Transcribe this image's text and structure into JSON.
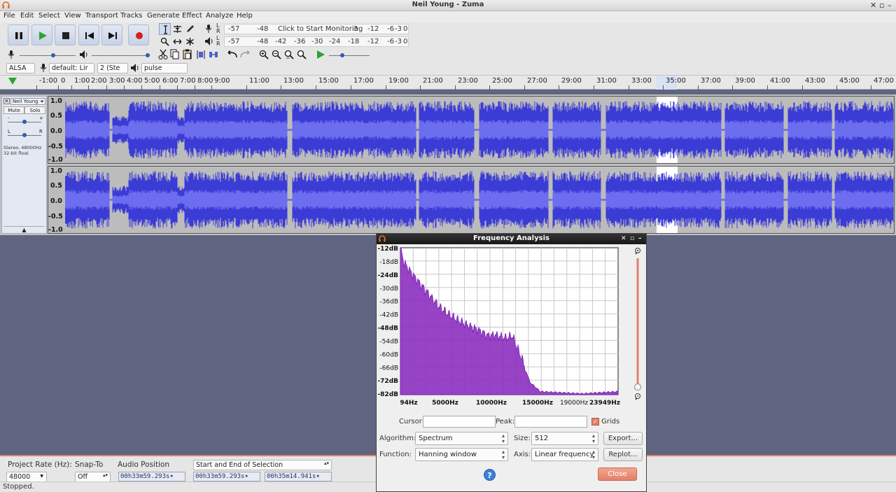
{
  "window": {
    "title": "Neil Young - Zuma"
  },
  "menu": [
    "File",
    "Edit",
    "Select",
    "View",
    "Transport",
    "Tracks",
    "Generate",
    "Effect",
    "Analyze",
    "Help"
  ],
  "meter": {
    "rec_channels": "L R",
    "rec_scale": [
      "-57",
      "-48",
      "Click to Start Monitoring",
      "3",
      "-12",
      "-6",
      "-3",
      "0"
    ],
    "play_scale": [
      "-57",
      "-48",
      "-42",
      "-36",
      "-30",
      "-24",
      "-18",
      "-12",
      "-6",
      "-3",
      "0"
    ]
  },
  "device": {
    "host": "ALSA",
    "rec_device": "default: Lir",
    "channels": "2 (Ste",
    "play_device": "pulse"
  },
  "ruler": {
    "labels": [
      "-1:00",
      "0",
      "1:00",
      "2:00",
      "3:00",
      "4:00",
      "5:00",
      "6:00",
      "7:00",
      "8:00",
      "9:00",
      "11:00",
      "13:00",
      "15:00",
      "17:00",
      "19:00",
      "21:00",
      "23:00",
      "25:00",
      "27:00",
      "29:00",
      "31:00",
      "33:00",
      "35:00",
      "37:00",
      "39:00",
      "41:00",
      "43:00",
      "45:00",
      "47:00"
    ]
  },
  "track": {
    "name": "Neil Young -",
    "mute": "Mute",
    "solo": "Solo",
    "gain_minus": "-",
    "gain_plus": "+",
    "pan_l": "L",
    "pan_r": "R",
    "info1": "Stereo, 48000Hz",
    "info2": "32-bit float",
    "scale": [
      "1.0",
      "0.5",
      "0.0",
      "-0.5",
      "-1.0"
    ]
  },
  "freq": {
    "title": "Frequency Analysis",
    "db_labels": [
      "-12dB",
      "-18dB",
      "-24dB",
      "-30dB",
      "-36dB",
      "-42dB",
      "-48dB",
      "-54dB",
      "-60dB",
      "-66dB",
      "-72dB",
      "-82dB"
    ],
    "hz_labels": [
      "94Hz",
      "5000Hz",
      "10000Hz",
      "15000Hz",
      "19000Hz",
      "23949Hz"
    ],
    "cursor_label": "Cursor:",
    "peak_label": "Peak:",
    "grids_label": "Grids",
    "algorithm_label": "Algorithm:",
    "algorithm_value": "Spectrum",
    "size_label": "Size:",
    "size_value": "512",
    "export_label": "Export...",
    "function_label": "Function:",
    "function_value": "Hanning window",
    "axis_label": "Axis:",
    "axis_value": "Linear frequency",
    "replot_label": "Replot...",
    "help_label": "?",
    "close_label": "Close",
    "grids_checked": true,
    "curve_color": "#8b2fbf"
  },
  "bottom": {
    "project_rate_label": "Project Rate (Hz):",
    "project_rate_value": "48000",
    "snap_label": "Snap-To",
    "snap_value": "Off",
    "audio_pos_label": "Audio Position",
    "selection_mode": "Start and End of Selection",
    "audio_pos": "00h33m59.293s",
    "sel_start": "00h33m59.293s",
    "sel_end": "00h35m14.941s"
  },
  "status": "Stopped.",
  "colors": {
    "waveform": "#3b3bd6",
    "waveform_rms": "#6d6df0",
    "selection": "#ffffff",
    "accent": "#e0826a"
  }
}
